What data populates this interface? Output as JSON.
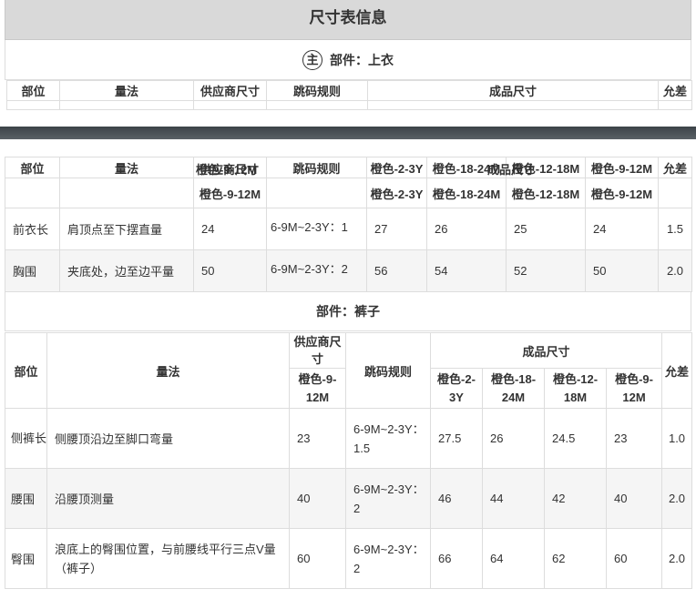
{
  "title": "尺寸表信息",
  "part1": {
    "badge": "主",
    "label": "部件：上衣",
    "headers": {
      "part": "部位",
      "method": "量法",
      "supplier_size": "供应商尺寸",
      "grading_rule": "跳码规则",
      "finished_size": "成品尺寸",
      "tolerance": "允差"
    },
    "supplier_overlap_a": "橙色-9-12M",
    "supplier_overlap_b": "供应商尺寸",
    "supplier_size_col": "橙色-9-12M",
    "finished_overlap": "成品尺寸",
    "size_cols": [
      "橙色-2-3Y",
      "橙色-18-24M",
      "橙色-12-18M",
      "橙色-9-12M"
    ],
    "rows": [
      {
        "part": "前衣长",
        "method": "肩顶点至下摆直量",
        "supplier": "24",
        "rule": "6-9M~2-3Y：1",
        "sizes": [
          "27",
          "26",
          "25",
          "24"
        ],
        "tolerance": "1.5"
      },
      {
        "part": "胸围",
        "method": "夹底处，边至边平量",
        "supplier": "50",
        "rule": "6-9M~2-3Y：2",
        "sizes": [
          "56",
          "54",
          "52",
          "50"
        ],
        "tolerance": "2.0"
      }
    ]
  },
  "part2": {
    "label": "部件：裤子",
    "headers": {
      "part": "部位",
      "method": "量法",
      "supplier_size": "供应商尺寸",
      "grading_rule": "跳码规则",
      "finished_size": "成品尺寸",
      "tolerance": "允差"
    },
    "supplier_size_col": "橙色-9-12M",
    "size_cols": [
      "橙色-2-3Y",
      "橙色-18-24M",
      "橙色-12-18M",
      "橙色-9-12M"
    ],
    "rows": [
      {
        "part": "侧裤长",
        "method": "侧腰顶沿边至脚口弯量",
        "supplier": "23",
        "rule": "6-9M~2-3Y：1.5",
        "sizes": [
          "27.5",
          "26",
          "24.5",
          "23"
        ],
        "tolerance": "1.0"
      },
      {
        "part": "腰围",
        "method": "沿腰顶测量",
        "supplier": "40",
        "rule": "6-9M~2-3Y：2",
        "sizes": [
          "46",
          "44",
          "42",
          "40"
        ],
        "tolerance": "2.0"
      },
      {
        "part": "臀围",
        "method": "浪底上的臀围位置，与前腰线平行三点V量（裤子）",
        "supplier": "60",
        "rule": "6-9M~2-3Y：2",
        "sizes": [
          "66",
          "64",
          "62",
          "60"
        ],
        "tolerance": "2.0"
      }
    ]
  }
}
